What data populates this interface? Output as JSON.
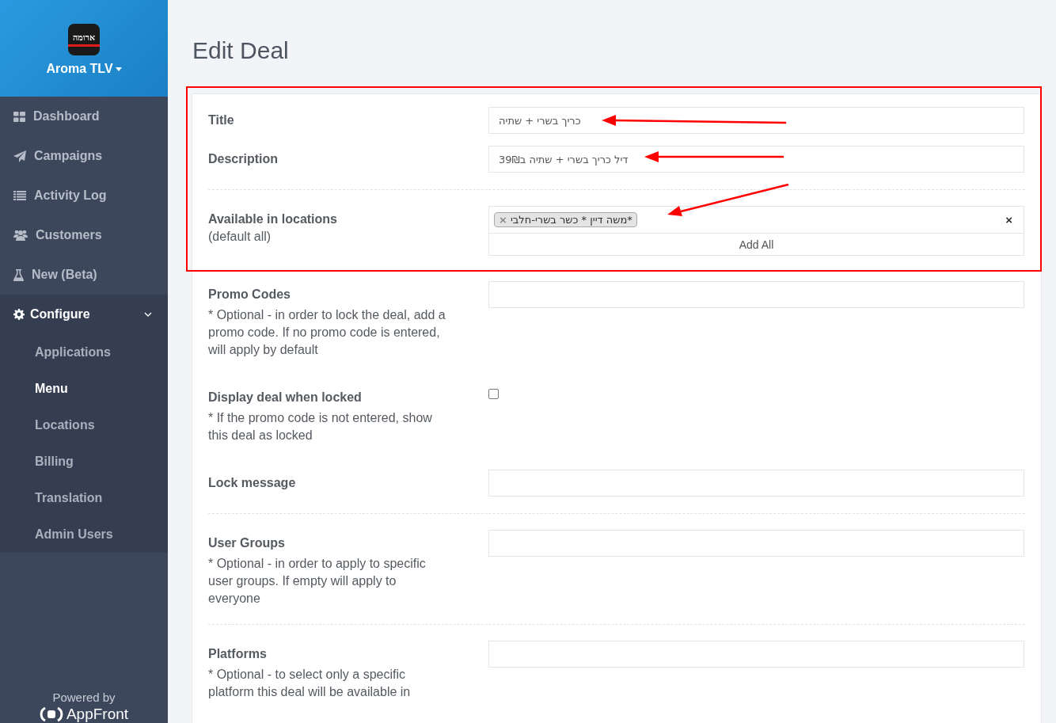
{
  "sidebar": {
    "logo_text": "ארומה",
    "account": "Aroma TLV",
    "nav": [
      {
        "label": "Dashboard",
        "selected": false
      },
      {
        "label": "Campaigns",
        "selected": false
      },
      {
        "label": "Activity Log",
        "selected": false
      },
      {
        "label": "Customers",
        "selected": false
      },
      {
        "label": "New (Beta)",
        "selected": false
      }
    ],
    "configure": {
      "label": "Configure",
      "expanded": true,
      "items": [
        {
          "label": "Applications",
          "selected": false
        },
        {
          "label": "Menu",
          "selected": true
        },
        {
          "label": "Locations",
          "selected": false
        },
        {
          "label": "Billing",
          "selected": false
        },
        {
          "label": "Translation",
          "selected": false
        },
        {
          "label": "Admin Users",
          "selected": false
        }
      ]
    },
    "powered_by": "Powered by",
    "brand": "AppFront"
  },
  "page": {
    "title": "Edit Deal",
    "fields": [
      {
        "kind": "text",
        "label": "Title",
        "value": "כריך בשרי + שתיה"
      },
      {
        "kind": "text",
        "label": "Description",
        "value": "דיל כריך בשרי + שתיה ב39₪"
      },
      {
        "kind": "tags",
        "label": "Available in locations",
        "sublabel": "(default all)",
        "divider_before": true,
        "tags": [
          {
            "remove": "×",
            "label": "*משה דיין * כשר בשרי-חלבי"
          }
        ],
        "clear": "×",
        "button": "Add All"
      },
      {
        "kind": "text",
        "label": "Promo Codes",
        "help": "* Optional - in order to lock the deal, add a promo code. If no promo code is entered, will apply by default"
      },
      {
        "kind": "checkbox",
        "label": "Display deal when locked",
        "help": "* If the promo code is not entered, show this deal as locked",
        "checked": false
      },
      {
        "kind": "text",
        "label": "Lock message"
      },
      {
        "kind": "text",
        "label": "User Groups",
        "divider_before": true,
        "help": "* Optional - in order to apply to specific user groups. If empty will apply to everyone"
      },
      {
        "kind": "text",
        "label": "Platforms",
        "divider_before": true,
        "help": "* Optional - to select only a specific platform this deal will be available in"
      }
    ]
  }
}
